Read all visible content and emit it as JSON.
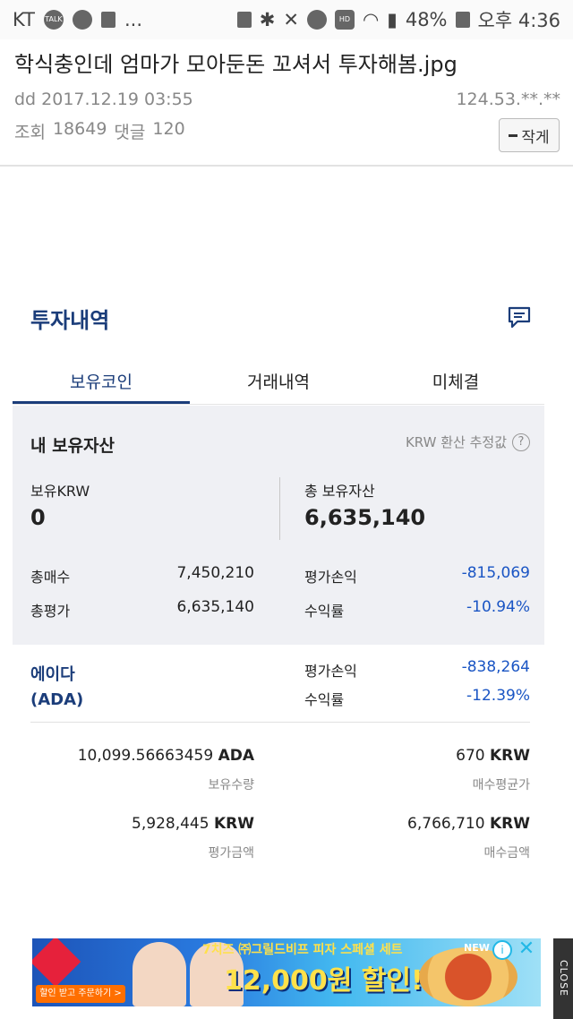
{
  "status_bar": {
    "carrier": "KT",
    "battery": "48%",
    "time": "오후 4:36",
    "icons": [
      "talk-icon",
      "bot-icon",
      "message-icon",
      "more-icon",
      "recycle-icon",
      "bluetooth-icon",
      "mute-icon",
      "alarm-icon",
      "hd-icon",
      "wifi-icon",
      "signal-icon",
      "battery-icon"
    ],
    "more_dots": "..."
  },
  "post": {
    "title": "학식충인데 엄마가 모아둔돈 꼬셔서 투자해봄.jpg",
    "author": "dd",
    "datetime": "2017.12.19 03:55",
    "ip": "124.53.**.**",
    "views_label": "조회",
    "views": "18649",
    "comments_label": "댓글",
    "comments": "120",
    "font_button_label": "작게"
  },
  "investment": {
    "title": "투자내역",
    "tabs": [
      {
        "label": "보유코인",
        "active": true
      },
      {
        "label": "거래내역",
        "active": false
      },
      {
        "label": "미체결",
        "active": false
      }
    ],
    "summary": {
      "title": "내 보유자산",
      "note": "KRW 환산 추정값",
      "krw_label": "보유KRW",
      "krw_value": "0",
      "total_label": "총 보유자산",
      "total_value": "6,635,140",
      "buy_total_label": "총매수",
      "buy_total_value": "7,450,210",
      "eval_total_label": "총평가",
      "eval_total_value": "6,635,140",
      "pnl_label": "평가손익",
      "pnl_value": "-815,069",
      "rate_label": "수익률",
      "rate_value": "-10.94%"
    },
    "coin": {
      "name_line1": "에이다",
      "name_line2": "(ADA)",
      "pnl_label": "평가손익",
      "pnl_value": "-838,264",
      "rate_label": "수익률",
      "rate_value": "-12.39%",
      "holding_amount": "10,099.56663459",
      "holding_unit": "ADA",
      "holding_label": "보유수량",
      "avg_price": "670",
      "avg_price_unit": "KRW",
      "avg_price_label": "매수평균가",
      "eval_amount": "5,928,445",
      "eval_amount_unit": "KRW",
      "eval_amount_label": "평가금액",
      "buy_amount": "6,766,710",
      "buy_amount_unit": "KRW",
      "buy_amount_label": "매수금액"
    }
  },
  "ad": {
    "headline_small": "7치즈 ㈜그릴드비프 피자 스페셜 세트",
    "headline_big": "12,000원 할인!",
    "cta": "할인 받고 주문하기 >",
    "new_badge": "NEW",
    "close_label": "CLOSE"
  },
  "colors": {
    "brand_navy": "#1b3d7a",
    "negative_blue": "#1a55c4",
    "summary_bg": "#eff0f4"
  }
}
